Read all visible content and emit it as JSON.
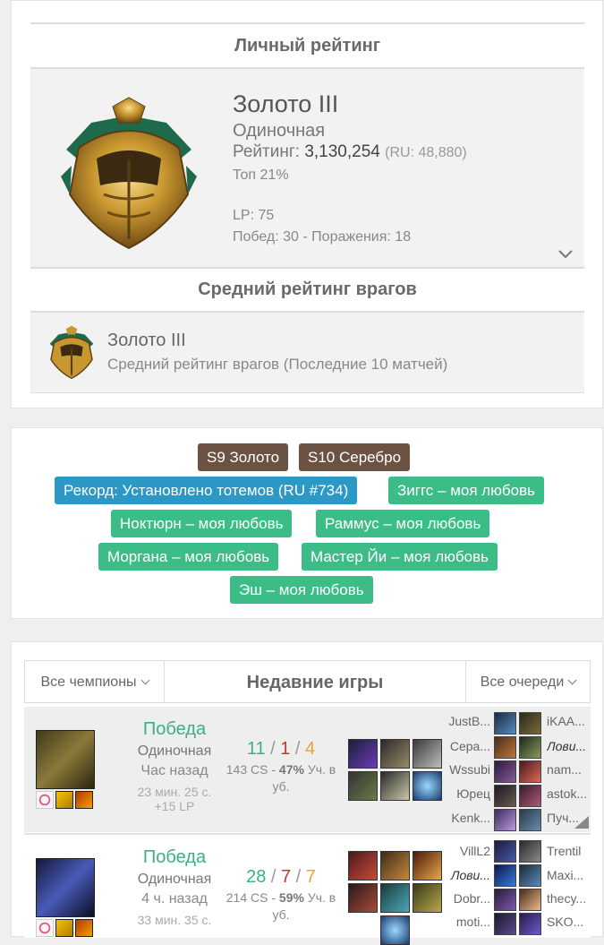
{
  "ranking": {
    "title": "Личный рейтинг",
    "tier": "Золото III",
    "queue": "Одиночная",
    "rating_label": "Рейтинг:",
    "rating_value": "3,130,254",
    "rating_ru": "(RU: 48,880)",
    "top": "Топ 21%",
    "lp": "LP: 75",
    "wins_losses": "Побед: 30 - Поражения: 18"
  },
  "enemies": {
    "title": "Средний рейтинг врагов",
    "tier": "Золото III",
    "subtitle": "Средний рейтинг врагов (Последние 10 матчей)"
  },
  "tags": [
    {
      "label": "S9 Золото",
      "type": "brown"
    },
    {
      "label": "S10 Серебро",
      "type": "brown"
    },
    {
      "label": "Рекорд: Установлено тотемов (RU #734)",
      "type": "blue"
    },
    {
      "label": "Зиггс – моя любовь",
      "type": "green"
    },
    {
      "label": "Ноктюрн – моя любовь",
      "type": "green"
    },
    {
      "label": "Раммус – моя любовь",
      "type": "green"
    },
    {
      "label": "Моргана – моя любовь",
      "type": "green"
    },
    {
      "label": "Мастер Йи – моя любовь",
      "type": "green"
    },
    {
      "label": "Эш – моя любовь",
      "type": "green"
    }
  ],
  "recent": {
    "title": "Недавние игры",
    "filter_champions": "Все чемпионы",
    "filter_queues": "Все очереди"
  },
  "games": [
    {
      "result": "Победа",
      "queue": "Одиночная",
      "time_ago": "Час назад",
      "duration": "23 мин. 25 с.",
      "lp": "+15 LP",
      "k": "11",
      "d": "1",
      "a": "4",
      "cs": "143 CS",
      "pct": "47%",
      "pct_label": "Уч. в уб.",
      "left_players": [
        "JustB...",
        "Сера...",
        "Wssubi",
        "Юрец",
        "Kenk..."
      ],
      "right_players": [
        "iKAA...",
        "Лови...",
        "nam...",
        "astok...",
        "Пуч..."
      ],
      "me_right_index": 1
    },
    {
      "result": "Победа",
      "queue": "Одиночная",
      "time_ago": "4 ч. назад",
      "duration": "33 мин. 35 с.",
      "k": "28",
      "d": "7",
      "a": "7",
      "cs": "214 CS",
      "pct": "59%",
      "pct_label": "Уч. в уб.",
      "left_players": [
        "VillL2",
        "Лови...",
        "Dobr...",
        "moti..."
      ],
      "right_players": [
        "Trentil",
        "Maxi...",
        "thecy...",
        "SKO..."
      ],
      "me_left_index": 1
    }
  ],
  "colors": {
    "win": "#3cb07e",
    "tag_brown": "#6b5243",
    "tag_blue": "#2c98c6",
    "tag_green": "#3cbd87"
  }
}
